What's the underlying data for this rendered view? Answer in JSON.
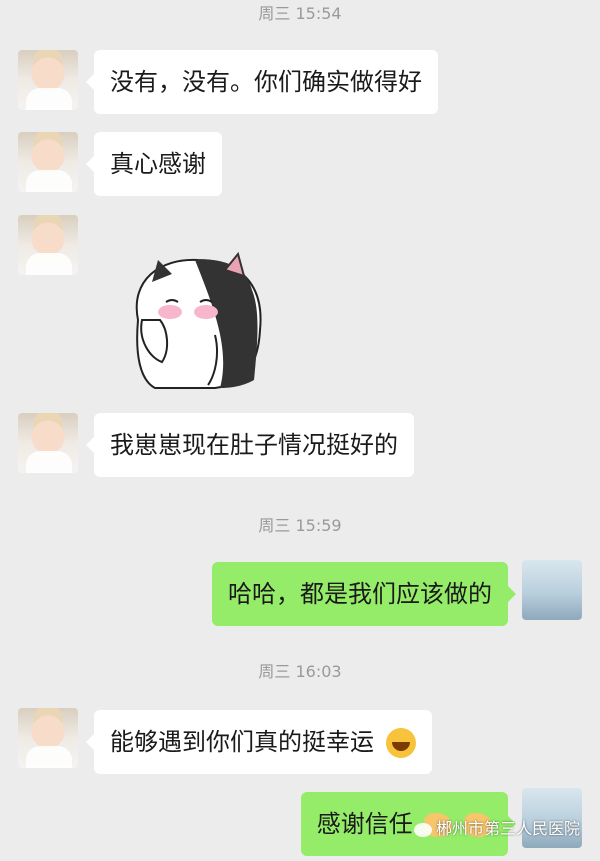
{
  "timestamps": [
    "周三 15:54",
    "周三 15:59",
    "周三 16:03"
  ],
  "messages": [
    {
      "text": "没有，没有。你们确实做得好"
    },
    {
      "text": "真心感谢"
    },
    {
      "text": "我崽崽现在肚子情况挺好的"
    },
    {
      "text": "哈哈，都是我们应该做的"
    },
    {
      "text": "能够遇到你们真的挺幸运"
    },
    {
      "text": "感谢信任"
    }
  ],
  "watermark": "郴州市第三人民医院",
  "icons": {
    "sticker": "cat-sticker-shy",
    "emoji_grin": "grinning-face-emoji",
    "emoji_hands": "handshake-emoji"
  }
}
